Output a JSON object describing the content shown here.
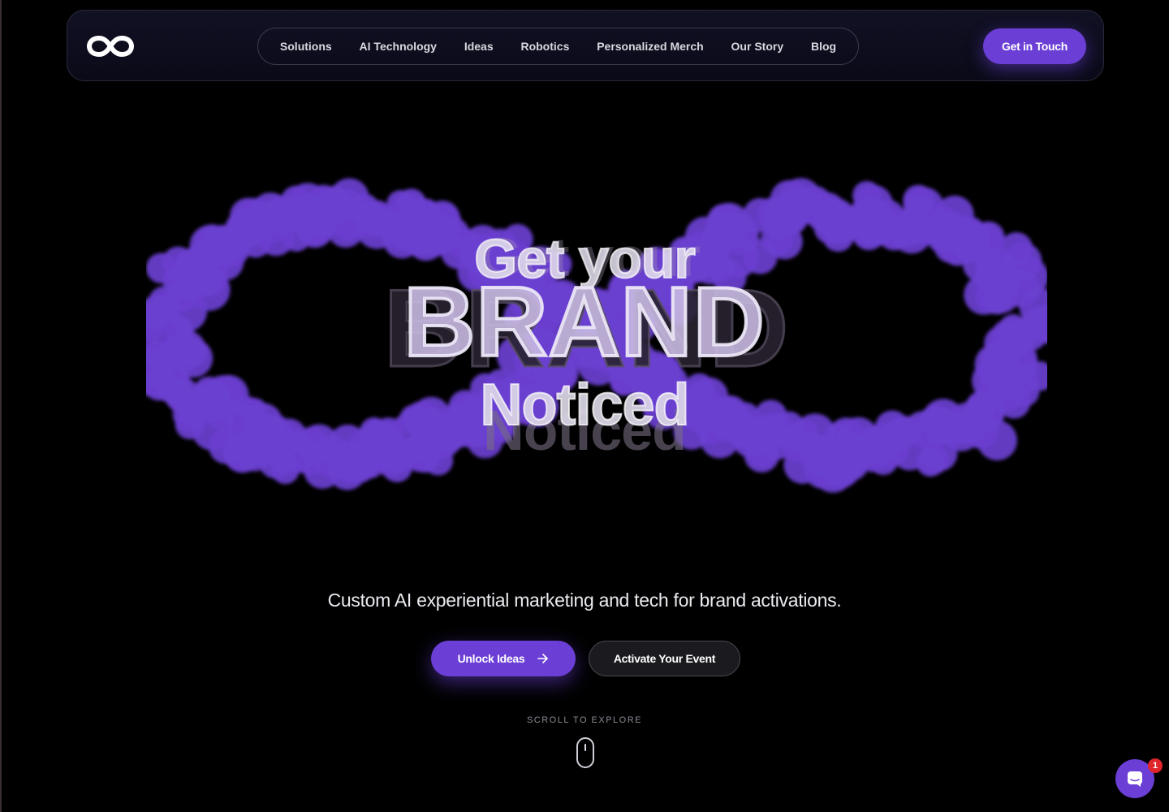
{
  "header": {
    "logo_name": "infinity-logo",
    "nav": [
      {
        "label": "Solutions"
      },
      {
        "label": "AI Technology"
      },
      {
        "label": "Ideas"
      },
      {
        "label": "Robotics"
      },
      {
        "label": "Personalized Merch"
      },
      {
        "label": "Our Story"
      },
      {
        "label": "Blog"
      }
    ],
    "cta_label": "Get in Touch"
  },
  "hero": {
    "line1": "Get your",
    "line2": "BRAND",
    "line3": "Noticed",
    "subtitle": "Custom AI experiential marketing and tech for brand activations.",
    "primary_button": "Unlock Ideas",
    "primary_button_icon": "arrow-right-icon",
    "secondary_button": "Activate Your Event",
    "scroll_hint": "SCROLL TO EXPLORE"
  },
  "chat": {
    "icon": "chat-icon",
    "badge_count": "1"
  },
  "colors": {
    "background": "#000000",
    "accent": "#6b3fd6",
    "infinity": "#6a3fd0",
    "badge": "#e0252b"
  }
}
